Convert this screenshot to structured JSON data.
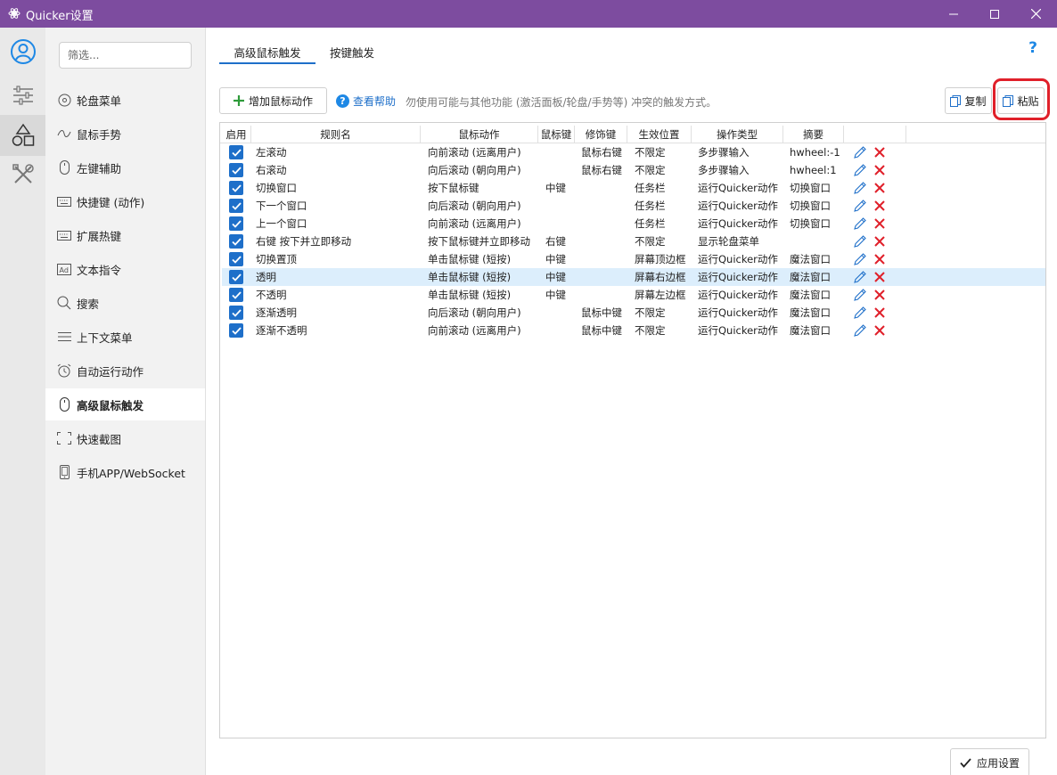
{
  "window": {
    "title": "Quicker设置",
    "controls": [
      "minimize",
      "maximize",
      "close"
    ]
  },
  "iconbar": [
    "user-icon",
    "sliders-icon",
    "shapes-icon",
    "tools-icon"
  ],
  "sidebar": {
    "filter_placeholder": "筛选...",
    "items": [
      {
        "label": "轮盘菜单",
        "icon": "circle-menu-icon"
      },
      {
        "label": "鼠标手势",
        "icon": "gesture-icon"
      },
      {
        "label": "左键辅助",
        "icon": "mouse-icon"
      },
      {
        "label": "快捷键 (动作)",
        "icon": "keyboard-icon"
      },
      {
        "label": "扩展热键",
        "icon": "keyboard-icon"
      },
      {
        "label": "文本指令",
        "icon": "ad-icon"
      },
      {
        "label": "搜索",
        "icon": "search-icon"
      },
      {
        "label": "上下文菜单",
        "icon": "menu-icon"
      },
      {
        "label": "自动运行动作",
        "icon": "alarm-icon"
      },
      {
        "label": "高级鼠标触发",
        "icon": "mouse-icon",
        "active": true
      },
      {
        "label": "快速截图",
        "icon": "screenshot-icon"
      },
      {
        "label": "手机APP/WebSocket",
        "icon": "phone-icon"
      }
    ]
  },
  "tabs": [
    {
      "label": "高级鼠标触发",
      "active": true
    },
    {
      "label": "按键触发",
      "active": false
    }
  ],
  "toolbar": {
    "add_label": "增加鼠标动作",
    "help_label": "查看帮助",
    "hint": "勿使用可能与其他功能 (激活面板/轮盘/手势等) 冲突的触发方式。",
    "copy_label": "复制",
    "paste_label": "粘贴"
  },
  "table": {
    "headers": [
      "启用",
      "规则名",
      "鼠标动作",
      "鼠标键",
      "修饰键",
      "生效位置",
      "操作类型",
      "摘要",
      ""
    ],
    "rows": [
      {
        "enabled": true,
        "name": "左滚动",
        "action": "向前滚动 (远离用户)",
        "button": "",
        "modifier": "鼠标右键",
        "position": "不限定",
        "op_type": "多步骤输入",
        "summary": "hwheel:-1"
      },
      {
        "enabled": true,
        "name": "右滚动",
        "action": "向后滚动 (朝向用户)",
        "button": "",
        "modifier": "鼠标右键",
        "position": "不限定",
        "op_type": "多步骤输入",
        "summary": "hwheel:1"
      },
      {
        "enabled": true,
        "name": "切换窗口",
        "action": "按下鼠标键",
        "button": "中键",
        "modifier": "",
        "position": "任务栏",
        "op_type": "运行Quicker动作",
        "summary": "切换窗口"
      },
      {
        "enabled": true,
        "name": "下一个窗口",
        "action": "向后滚动 (朝向用户)",
        "button": "",
        "modifier": "",
        "position": "任务栏",
        "op_type": "运行Quicker动作",
        "summary": "切换窗口"
      },
      {
        "enabled": true,
        "name": "上一个窗口",
        "action": "向前滚动 (远离用户)",
        "button": "",
        "modifier": "",
        "position": "任务栏",
        "op_type": "运行Quicker动作",
        "summary": "切换窗口"
      },
      {
        "enabled": true,
        "name": "右键 按下并立即移动",
        "action": "按下鼠标键并立即移动",
        "button": "右键",
        "modifier": "",
        "position": "不限定",
        "op_type": "显示轮盘菜单",
        "summary": ""
      },
      {
        "enabled": true,
        "name": "切换置顶",
        "action": "单击鼠标键 (短按)",
        "button": "中键",
        "modifier": "",
        "position": "屏幕顶边框",
        "op_type": "运行Quicker动作",
        "summary": "魔法窗口"
      },
      {
        "enabled": true,
        "name": "透明",
        "action": "单击鼠标键 (短按)",
        "button": "中键",
        "modifier": "",
        "position": "屏幕右边框",
        "op_type": "运行Quicker动作",
        "summary": "魔法窗口",
        "selected": true
      },
      {
        "enabled": true,
        "name": "不透明",
        "action": "单击鼠标键 (短按)",
        "button": "中键",
        "modifier": "",
        "position": "屏幕左边框",
        "op_type": "运行Quicker动作",
        "summary": "魔法窗口"
      },
      {
        "enabled": true,
        "name": "逐渐透明",
        "action": "向后滚动 (朝向用户)",
        "button": "",
        "modifier": "鼠标中键",
        "position": "不限定",
        "op_type": "运行Quicker动作",
        "summary": "魔法窗口"
      },
      {
        "enabled": true,
        "name": "逐渐不透明",
        "action": "向前滚动 (远离用户)",
        "button": "",
        "modifier": "鼠标中键",
        "position": "不限定",
        "op_type": "运行Quicker动作",
        "summary": "魔法窗口"
      }
    ]
  },
  "footer": {
    "apply_label": "应用设置"
  },
  "colors": {
    "titlebar": "#7d4c9f",
    "accent": "#1e6fc9",
    "highlight_box": "#e0202a",
    "add_icon": "#2e9b3a",
    "delete_icon": "#e0202a"
  }
}
